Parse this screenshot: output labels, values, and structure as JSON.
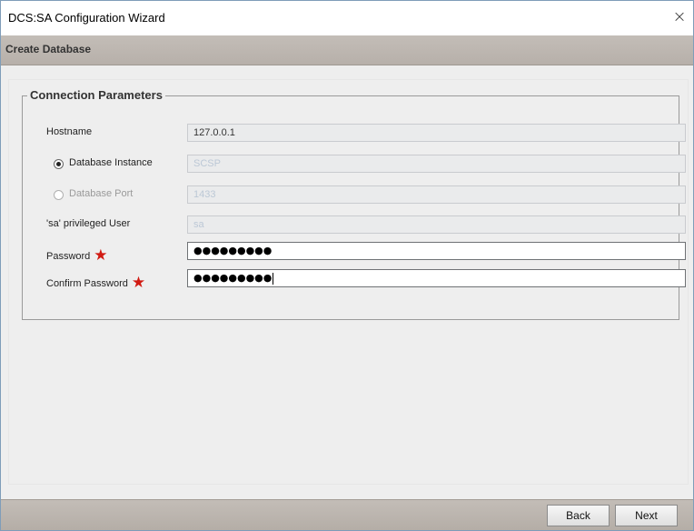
{
  "window": {
    "title": "DCS:SA Configuration Wizard",
    "close_glyph": "×"
  },
  "header": {
    "title": "Create Database"
  },
  "group": {
    "legend": "Connection Parameters",
    "hostname": {
      "label": "Hostname",
      "value": "127.0.0.1"
    },
    "instance": {
      "label": "Database Instance",
      "value": "SCSP",
      "selected": true
    },
    "port": {
      "label": "Database Port",
      "value": "1433",
      "selected": false
    },
    "user": {
      "label": "'sa' privileged User",
      "value": "sa"
    },
    "password": {
      "label": "Password",
      "value": "●●●●●●●●●",
      "required_mark": "★"
    },
    "confirm": {
      "label": "Confirm Password",
      "value": "●●●●●●●●●",
      "required_mark": "★"
    }
  },
  "footer": {
    "back_label": "Back",
    "next_label": "Next"
  },
  "colors": {
    "required": "#d11a12",
    "band": "#bbb4ae"
  }
}
